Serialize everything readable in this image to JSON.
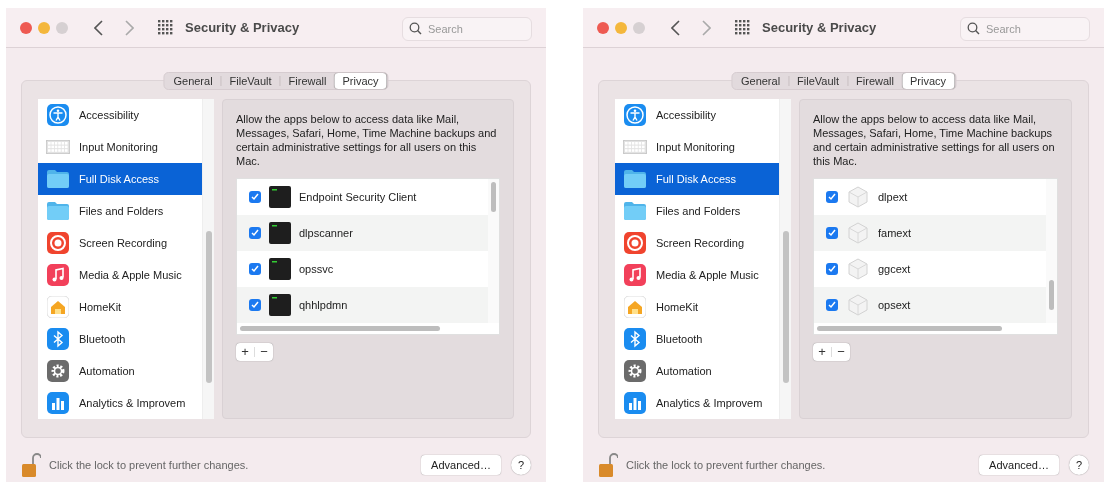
{
  "windows": [
    {
      "title": "Security & Privacy",
      "search": {
        "placeholder": "Search"
      },
      "tabs": [
        {
          "label": "General",
          "selected": false
        },
        {
          "label": "FileVault",
          "selected": false
        },
        {
          "label": "Firewall",
          "selected": false
        },
        {
          "label": "Privacy",
          "selected": true
        }
      ],
      "sidebar": {
        "items": [
          {
            "label": "Accessibility",
            "kind": "accessibility",
            "selected": false
          },
          {
            "label": "Input Monitoring",
            "kind": "keyboard",
            "selected": false
          },
          {
            "label": "Full Disk Access",
            "kind": "folder",
            "selected": true
          },
          {
            "label": "Files and Folders",
            "kind": "folder",
            "selected": false
          },
          {
            "label": "Screen Recording",
            "kind": "record",
            "selected": false
          },
          {
            "label": "Media & Apple Music",
            "kind": "music",
            "selected": false
          },
          {
            "label": "HomeKit",
            "kind": "home",
            "selected": false
          },
          {
            "label": "Bluetooth",
            "kind": "bluetooth",
            "selected": false
          },
          {
            "label": "Automation",
            "kind": "gear",
            "selected": false
          },
          {
            "label": "Analytics & Improvem",
            "kind": "chart",
            "selected": false
          }
        ]
      },
      "description": "Allow the apps below to access data like Mail, Messages, Safari, Home, Time Machine backups and certain administrative settings for all users on this Mac.",
      "apps": [
        {
          "name": "Endpoint Security Client",
          "kind": "terminal",
          "checked": true
        },
        {
          "name": "dlpscanner",
          "kind": "terminal",
          "checked": true
        },
        {
          "name": "opssvc",
          "kind": "terminal",
          "checked": true
        },
        {
          "name": "qhhlpdmn",
          "kind": "terminal",
          "checked": true
        }
      ],
      "add_remove": [
        "+",
        "−"
      ],
      "footer": {
        "text": "Click the lock to prevent further changes.",
        "advanced": "Advanced…",
        "help": "?"
      }
    },
    {
      "title": "Security & Privacy",
      "search": {
        "placeholder": "Search"
      },
      "tabs": [
        {
          "label": "General",
          "selected": false
        },
        {
          "label": "FileVault",
          "selected": false
        },
        {
          "label": "Firewall",
          "selected": false
        },
        {
          "label": "Privacy",
          "selected": true
        }
      ],
      "sidebar": {
        "items": [
          {
            "label": "Accessibility",
            "kind": "accessibility",
            "selected": false
          },
          {
            "label": "Input Monitoring",
            "kind": "keyboard",
            "selected": false
          },
          {
            "label": "Full Disk Access",
            "kind": "folder",
            "selected": true
          },
          {
            "label": "Files and Folders",
            "kind": "folder",
            "selected": false
          },
          {
            "label": "Screen Recording",
            "kind": "record",
            "selected": false
          },
          {
            "label": "Media & Apple Music",
            "kind": "music",
            "selected": false
          },
          {
            "label": "HomeKit",
            "kind": "home",
            "selected": false
          },
          {
            "label": "Bluetooth",
            "kind": "bluetooth",
            "selected": false
          },
          {
            "label": "Automation",
            "kind": "gear",
            "selected": false
          },
          {
            "label": "Analytics & Improvem",
            "kind": "chart",
            "selected": false
          }
        ]
      },
      "description": "Allow the apps below to access data like Mail, Messages, Safari, Home, Time Machine backups and certain administrative settings for all users on this Mac.",
      "apps": [
        {
          "name": "dlpext",
          "kind": "extension",
          "checked": true
        },
        {
          "name": "famext",
          "kind": "extension",
          "checked": true
        },
        {
          "name": "ggcext",
          "kind": "extension",
          "checked": true
        },
        {
          "name": "opsext",
          "kind": "extension",
          "checked": true
        }
      ],
      "add_remove": [
        "+",
        "−"
      ],
      "footer": {
        "text": "Click the lock to prevent further changes.",
        "advanced": "Advanced…",
        "help": "?"
      }
    }
  ]
}
